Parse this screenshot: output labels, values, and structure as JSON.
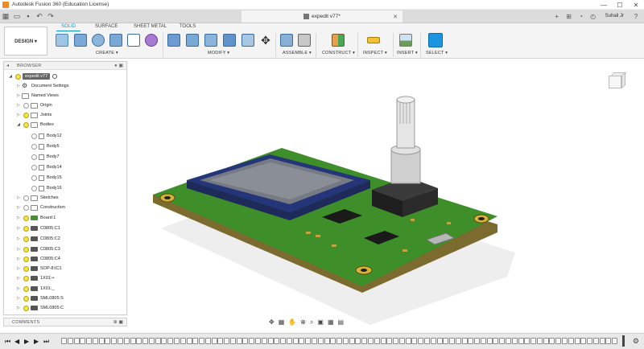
{
  "window": {
    "title": "Autodesk Fusion 360 (Education License)",
    "controls": [
      "—",
      "☐",
      "✕"
    ]
  },
  "doc_tab": {
    "name": "expedit v77*",
    "close": "✕"
  },
  "top_right": {
    "user": "Suhail Jr",
    "help": "?"
  },
  "ribbon": {
    "workspace": "DESIGN ▾",
    "tabs": [
      {
        "label": "SOLID",
        "active": true
      },
      {
        "label": "SURFACE",
        "active": false
      },
      {
        "label": "SHEET METAL",
        "active": false
      },
      {
        "label": "TOOLS",
        "active": false
      }
    ],
    "groups": [
      "CREATE ▾",
      "MODIFY ▾",
      "ASSEMBLE ▾",
      "CONSTRUCT ▾",
      "INSPECT ▾",
      "INSERT ▾",
      "SELECT ▾"
    ]
  },
  "browser": {
    "title": "BROWSER",
    "root": "expedit v77",
    "items": [
      {
        "label": "Document Settings"
      },
      {
        "label": "Named Views"
      },
      {
        "label": "Origin"
      },
      {
        "label": "Joints"
      },
      {
        "label": "Bodies"
      },
      {
        "label": "Body12"
      },
      {
        "label": "Body5"
      },
      {
        "label": "Body7"
      },
      {
        "label": "Body14"
      },
      {
        "label": "Body15"
      },
      {
        "label": "Body16"
      },
      {
        "label": "Sketches"
      },
      {
        "label": "Construction"
      },
      {
        "label": "Board:1"
      },
      {
        "label": "C0805:C1"
      },
      {
        "label": "C0805:C2"
      },
      {
        "label": "C0805:C3"
      },
      {
        "label": "C0805:C4"
      },
      {
        "label": "SOP-8:IC1"
      },
      {
        "label": "1X01:+"
      },
      {
        "label": "1X01:_"
      },
      {
        "label": "SML0805:S"
      },
      {
        "label": "SML0805:C"
      }
    ]
  },
  "comments": {
    "title": "COMMENTS"
  },
  "nav_icons": [
    "orbit-icon",
    "pan-icon",
    "zoom-icon",
    "look-icon",
    "display-icon",
    "grid-icon",
    "view-icon"
  ],
  "timeline": {
    "controls": [
      "⏮",
      "◀",
      "▶",
      "▶",
      "⏭"
    ],
    "feature_count": 89
  }
}
